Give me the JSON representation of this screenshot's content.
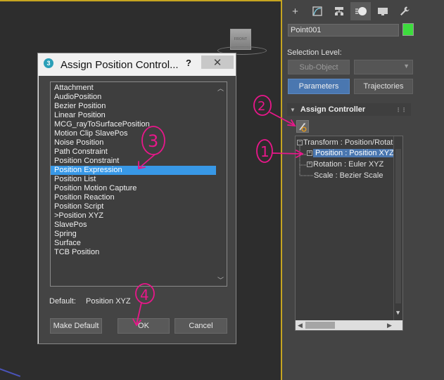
{
  "viewport": {
    "viewcube_label": "FRONT"
  },
  "command_panel": {
    "tabs": [
      {
        "icon": "create-plus-icon",
        "glyph": "+"
      },
      {
        "icon": "modify-curve-icon",
        "glyph": "⬚"
      },
      {
        "icon": "hierarchy-icon",
        "glyph": "⚇"
      },
      {
        "icon": "motion-icon",
        "glyph": "◐"
      },
      {
        "icon": "display-monitor-icon",
        "glyph": "▭"
      },
      {
        "icon": "utilities-wrench-icon",
        "glyph": "🔧"
      }
    ],
    "object_name": "Point001",
    "object_color": "#3ddc3d",
    "selection_level_label": "Selection Level:",
    "subobject_label": "Sub-Object",
    "parameters_label": "Parameters",
    "trajectories_label": "Trajectories",
    "rollout_title": "Assign Controller",
    "tree": {
      "root": "Transform : Position/Rotat",
      "position": "Position : Position XYZ",
      "rotation": "Rotation : Euler XYZ",
      "scale": "Scale : Bezier Scale"
    }
  },
  "dialog": {
    "title": "Assign Position Control...",
    "help": "?",
    "close": "✕",
    "items": [
      "Attachment",
      "AudioPosition",
      "Bezier Position",
      "Linear Position",
      "MCG_rayToSurfacePosition",
      "Motion Clip SlavePos",
      "Noise Position",
      "Path Constraint",
      "Position Constraint",
      "Position Expression",
      "Position List",
      "Position Motion Capture",
      "Position Reaction",
      "Position Script",
      ">Position XYZ",
      "SlavePos",
      "Spring",
      "Surface",
      "TCB Position"
    ],
    "selected_index": 9,
    "default_label": "Default:",
    "default_value": "Position XYZ",
    "make_default_label": "Make Default",
    "ok_label": "OK",
    "cancel_label": "Cancel"
  },
  "annotations": [
    "1",
    "2",
    "3",
    "4"
  ],
  "colors": {
    "annotation": "#e8178a",
    "selection": "#3898e6",
    "accent_button": "#4a77b0"
  }
}
